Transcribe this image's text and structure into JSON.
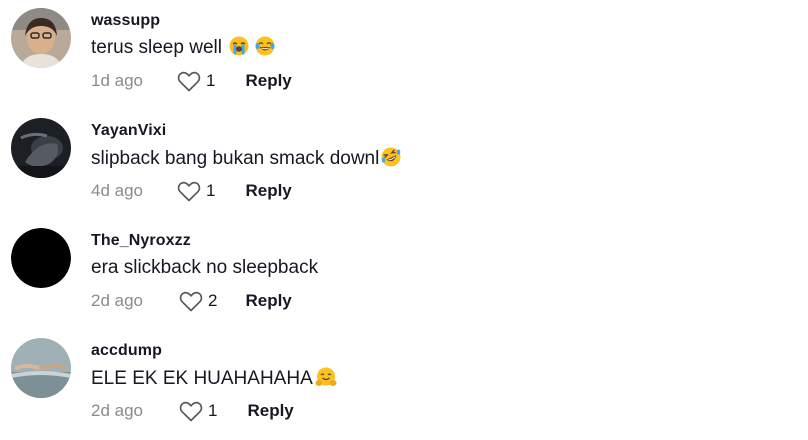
{
  "comments": [
    {
      "username": "wassupp",
      "text": "terus sleep well ",
      "emojis": [
        "loudly-crying-face-emoji",
        "face-with-tears-of-joy-emoji"
      ],
      "time": "1d ago",
      "likes": "1",
      "reply_label": "Reply"
    },
    {
      "username": "YayanVixi",
      "text": "slipback bang bukan smack downl",
      "emojis": [
        "rolling-on-floor-laughing-emoji"
      ],
      "time": "4d ago",
      "likes": "1",
      "reply_label": "Reply"
    },
    {
      "username": "The_Nyroxzz",
      "text": "era slickback no sleepback",
      "emojis": [],
      "time": "2d ago",
      "likes": "2",
      "reply_label": "Reply"
    },
    {
      "username": "accdump",
      "text": "ELE EK EK HUAHAHAHA",
      "emojis": [
        "hugging-face-emoji"
      ],
      "time": "2d ago",
      "likes": "1",
      "reply_label": "Reply"
    }
  ],
  "colors": {
    "text_primary": "#161823",
    "text_secondary": "#8a8b91",
    "icon": "#565860"
  }
}
